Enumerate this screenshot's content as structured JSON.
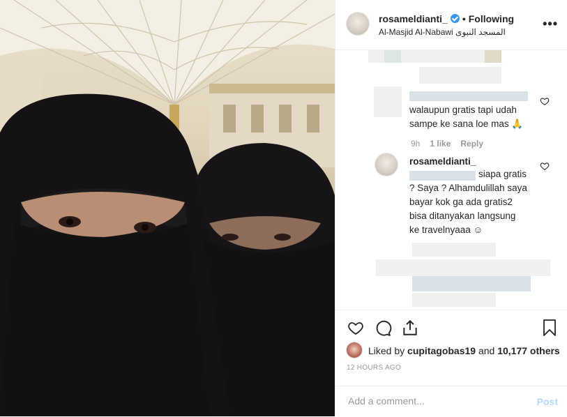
{
  "header": {
    "username": "rosameldianti_",
    "separator": "•",
    "following_label": "Following",
    "location": "Al-Masjid Al-Nabawi المسجد النبوى",
    "more_label": "•••"
  },
  "comments": [
    {
      "text": "walaupun gratis tapi udah sampe ke sana loe mas 🙏",
      "time": "9h",
      "likes": "1 like",
      "reply_label": "Reply"
    },
    {
      "username": "rosameldianti_",
      "text": "siapa gratis ? Saya ? Alhamdulillah saya bayar kok ga ada gratis2 bisa ditanyakan langsung ke travelnyaaa ☺"
    }
  ],
  "actions": {
    "like": "heart-icon",
    "comment": "comment-icon",
    "share": "share-icon",
    "save": "bookmark-icon"
  },
  "likes": {
    "prefix": "Liked by",
    "user": "cupitagobas19",
    "joiner": "and",
    "others": "10,177 others"
  },
  "timestamp": "12 HOURS AGO",
  "comment_box": {
    "placeholder": "Add a comment...",
    "post_label": "Post"
  }
}
